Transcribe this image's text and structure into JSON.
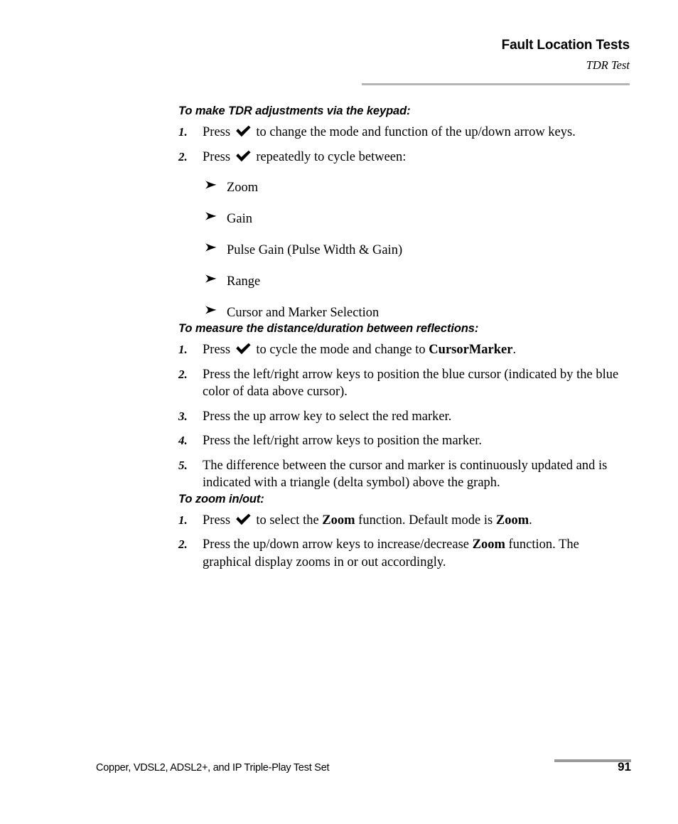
{
  "header": {
    "title": "Fault Location Tests",
    "subtitle": "TDR Test"
  },
  "sections": [
    {
      "heading": "To make TDR adjustments via the keypad:",
      "steps": [
        {
          "num": "1.",
          "before": "Press ",
          "icon": "check-icon",
          "after": " to change the mode and function of the up/down arrow keys."
        },
        {
          "num": "2.",
          "before": "Press ",
          "icon": "check-icon",
          "after": " repeatedly to cycle between:"
        }
      ],
      "bullets": [
        "Zoom",
        "Gain",
        "Pulse Gain (Pulse Width & Gain)",
        "Range",
        "Cursor and Marker Selection"
      ]
    },
    {
      "heading": "To measure the distance/duration between reflections:",
      "steps": [
        {
          "num": "1.",
          "before": "Press ",
          "icon": "check-icon",
          "after": " to cycle the mode and change to ",
          "bold": "CursorMarker",
          "tail": "."
        },
        {
          "num": "2.",
          "text": "Press the left/right arrow keys to position the blue cursor (indicated by the blue color of data above cursor)."
        },
        {
          "num": "3.",
          "text": "Press the up arrow key to select the red marker."
        },
        {
          "num": "4.",
          "text": "Press the left/right arrow keys to position the marker."
        },
        {
          "num": "5.",
          "text": "The difference between the cursor and marker is continuously updated and is indicated with a triangle (delta symbol) above the graph."
        }
      ]
    },
    {
      "heading": "To zoom in/out:",
      "steps": [
        {
          "num": "1.",
          "before": "Press ",
          "icon": "check-icon",
          "after": " to select the ",
          "bold": "Zoom",
          "tail": " function. Default mode is ",
          "bold2": "Zoom",
          "tail2": "."
        },
        {
          "num": "2.",
          "before": "Press the up/down arrow keys to increase/decrease ",
          "bold": "Zoom",
          "tail": " function. The graphical display zooms in or out accordingly."
        }
      ]
    }
  ],
  "footer": {
    "text": "Copper, VDSL2, ADSL2+, and IP Triple-Play Test Set",
    "page": "91"
  },
  "colors": {
    "rule": "#b4b4b4",
    "footer_bar": "#9a9a9a",
    "text": "#000000"
  }
}
